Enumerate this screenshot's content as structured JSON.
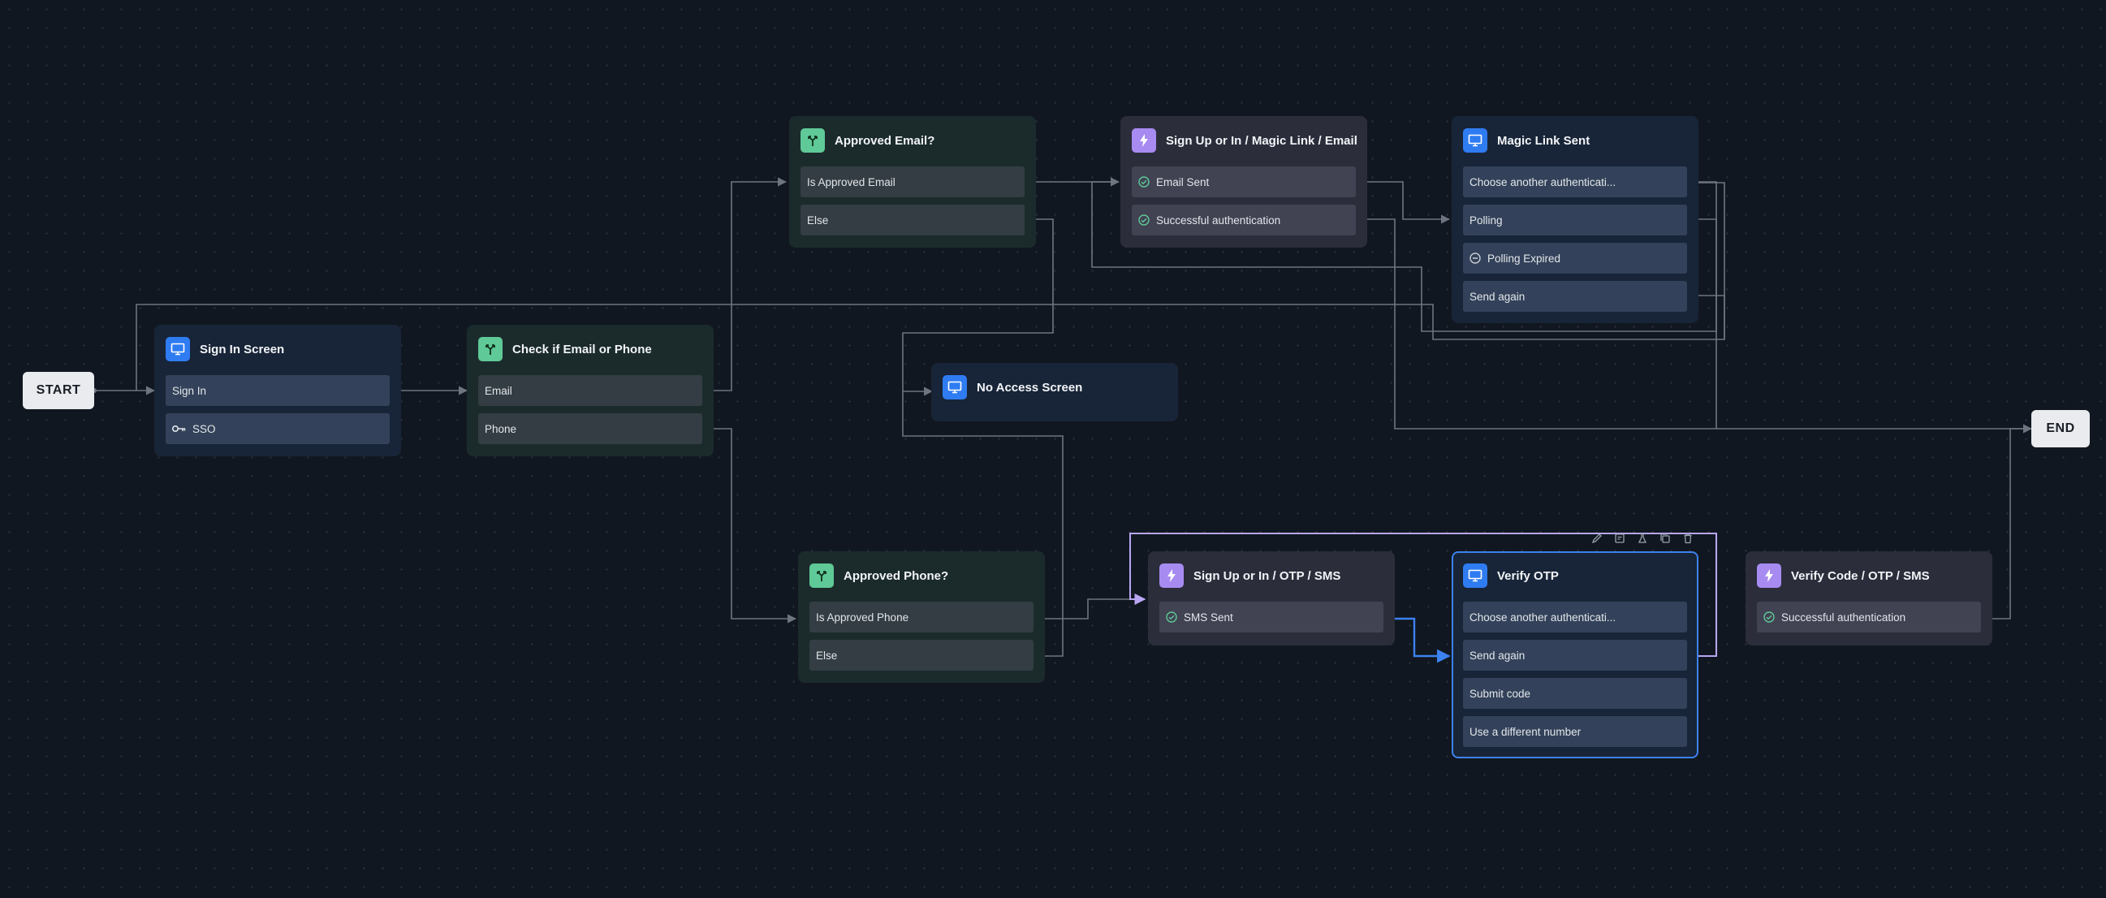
{
  "terminals": {
    "start": "START",
    "end": "END"
  },
  "colors": {
    "canvas": "#111720",
    "edge": "#6e7580",
    "active_edge": "#3c82f0",
    "selected_loop": "#b8a6f4",
    "selection_border": "#3c82f0"
  },
  "nodes": {
    "sign_in_screen": {
      "title": "Sign In Screen",
      "icon": "screen-icon",
      "rows": [
        "Sign In",
        "SSO"
      ],
      "sso_icon": "key-icon"
    },
    "check_email_phone": {
      "title": "Check if Email or Phone",
      "icon": "branch-icon",
      "rows": [
        "Email",
        "Phone"
      ]
    },
    "approved_email": {
      "title": "Approved Email?",
      "icon": "branch-icon",
      "rows": [
        "Is Approved Email",
        "Else"
      ]
    },
    "magic_link_flow": {
      "title": "Sign Up or In / Magic Link / Email",
      "icon": "lightning-icon",
      "rows": [
        "Email Sent",
        "Successful authentication"
      ]
    },
    "magic_link_sent": {
      "title": "Magic Link Sent",
      "icon": "screen-icon",
      "rows": [
        "Choose another authenticati...",
        "Polling",
        "Polling Expired",
        "Send again"
      ]
    },
    "no_access_screen": {
      "title": "No Access Screen",
      "icon": "screen-icon"
    },
    "approved_phone": {
      "title": "Approved Phone?",
      "icon": "branch-icon",
      "rows": [
        "Is Approved Phone",
        "Else"
      ]
    },
    "otp_sms_flow": {
      "title": "Sign Up or In / OTP / SMS",
      "icon": "lightning-icon",
      "rows": [
        "SMS Sent"
      ]
    },
    "verify_otp": {
      "title": "Verify OTP",
      "icon": "screen-icon",
      "rows": [
        "Choose another authenticati...",
        "Send again",
        "Submit code",
        "Use a different number"
      ],
      "selected": true
    },
    "verify_code_flow": {
      "title": "Verify Code / OTP / SMS",
      "icon": "lightning-icon",
      "rows": [
        "Successful authentication"
      ]
    }
  },
  "toolbar_icons": [
    "pencil-icon",
    "note-icon",
    "flask-icon",
    "copy-icon",
    "trash-icon"
  ]
}
